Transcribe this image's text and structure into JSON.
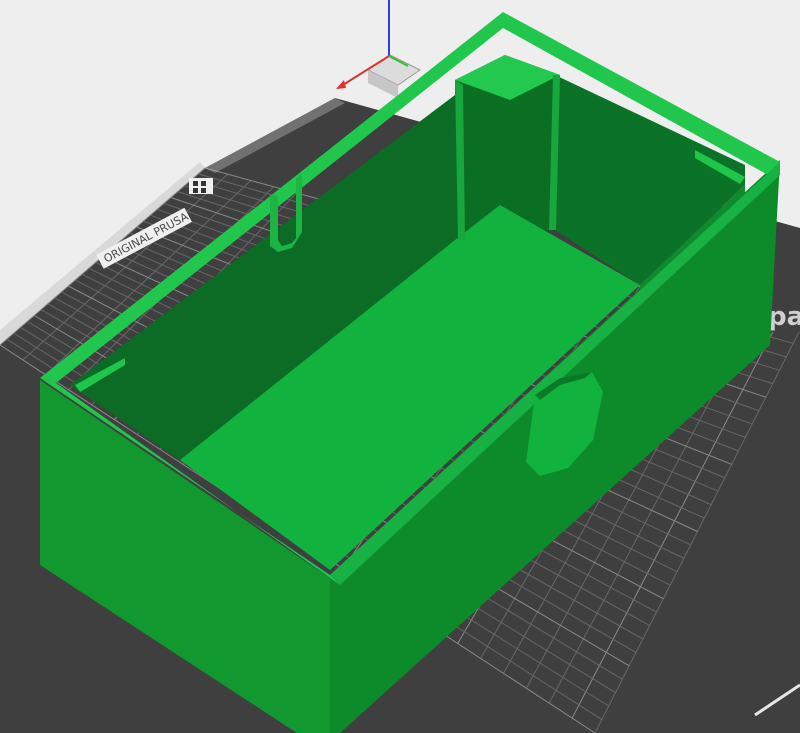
{
  "viewport": {
    "bed_label": "ORIGINAL PRUSA",
    "bed_brand": "pa",
    "colors": {
      "background": "#eeeeee",
      "bed": "#3f3f3f",
      "bed_grid": "#6a6a6a",
      "model_light": "#1fb84a",
      "model_mid": "#12a03a",
      "model_dark": "#0b7f28",
      "axis_x": "#e03030",
      "axis_y": "#30c030",
      "axis_z": "#2040e0"
    }
  }
}
